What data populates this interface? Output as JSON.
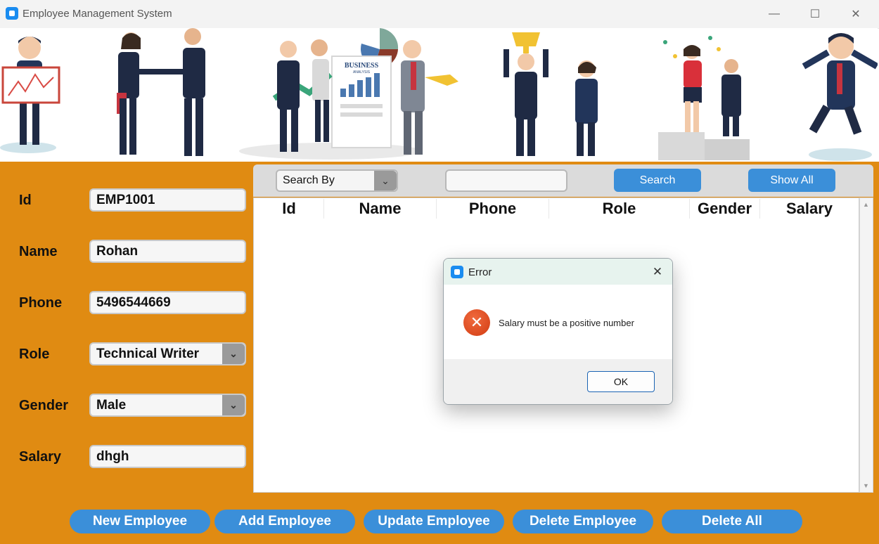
{
  "window": {
    "title": "Employee Management System",
    "minimize": "—",
    "maximize": "☐",
    "close": "✕"
  },
  "banner": {
    "caption": "BUSINESS",
    "caption_sub": "ANALYSIS"
  },
  "form": {
    "id": {
      "label": "Id",
      "value": "EMP1001"
    },
    "name": {
      "label": "Name",
      "value": "Rohan"
    },
    "phone": {
      "label": "Phone",
      "value": "5496544669"
    },
    "role": {
      "label": "Role",
      "value": "Technical Writer"
    },
    "gender": {
      "label": "Gender",
      "value": "Male"
    },
    "salary": {
      "label": "Salary",
      "value": "dhgh"
    }
  },
  "search": {
    "by_label": "Search By",
    "search_button": "Search",
    "show_all_button": "Show All",
    "query": ""
  },
  "table": {
    "columns": [
      "Id",
      "Name",
      "Phone",
      "Role",
      "Gender",
      "Salary"
    ]
  },
  "actions": [
    "New Employee",
    "Add Employee",
    "Update Employee",
    "Delete Employee",
    "Delete All"
  ],
  "dialog": {
    "title": "Error",
    "message": "Salary must be a positive number",
    "ok": "OK",
    "close": "✕",
    "icon": "✕"
  },
  "colors": {
    "accent": "#3b8fd9",
    "background": "#e08b12",
    "error": "#d23c12"
  }
}
